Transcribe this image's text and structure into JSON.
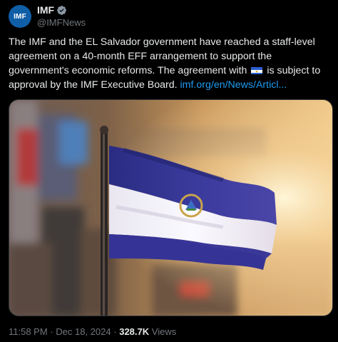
{
  "account": {
    "avatar_text": "IMF",
    "display_name": "IMF",
    "handle": "@IMFNews",
    "avatar_color": "#0f5ea6",
    "verified_color": "#8b98a5"
  },
  "tweet": {
    "text_before_flag": "The IMF and the EL Salvador government have reached a staff-level agreement on a 40-month EFF arrangement to support the government's economic reforms. The agreement with ",
    "flag_emoji": "el-salvador-flag",
    "text_after_flag": " is subject to approval by the IMF Executive Board. ",
    "link_text": "imf.org/en/News/Articl..."
  },
  "media": {
    "description_icon": "el-salvador-flag-photo",
    "flag_blue": "#2b2f8f",
    "flag_white": "#f3f1f7"
  },
  "meta": {
    "time": "11:58 PM",
    "separator": "·",
    "date": "Dec 18, 2024",
    "views_count": "328.7K",
    "views_label": "Views"
  }
}
